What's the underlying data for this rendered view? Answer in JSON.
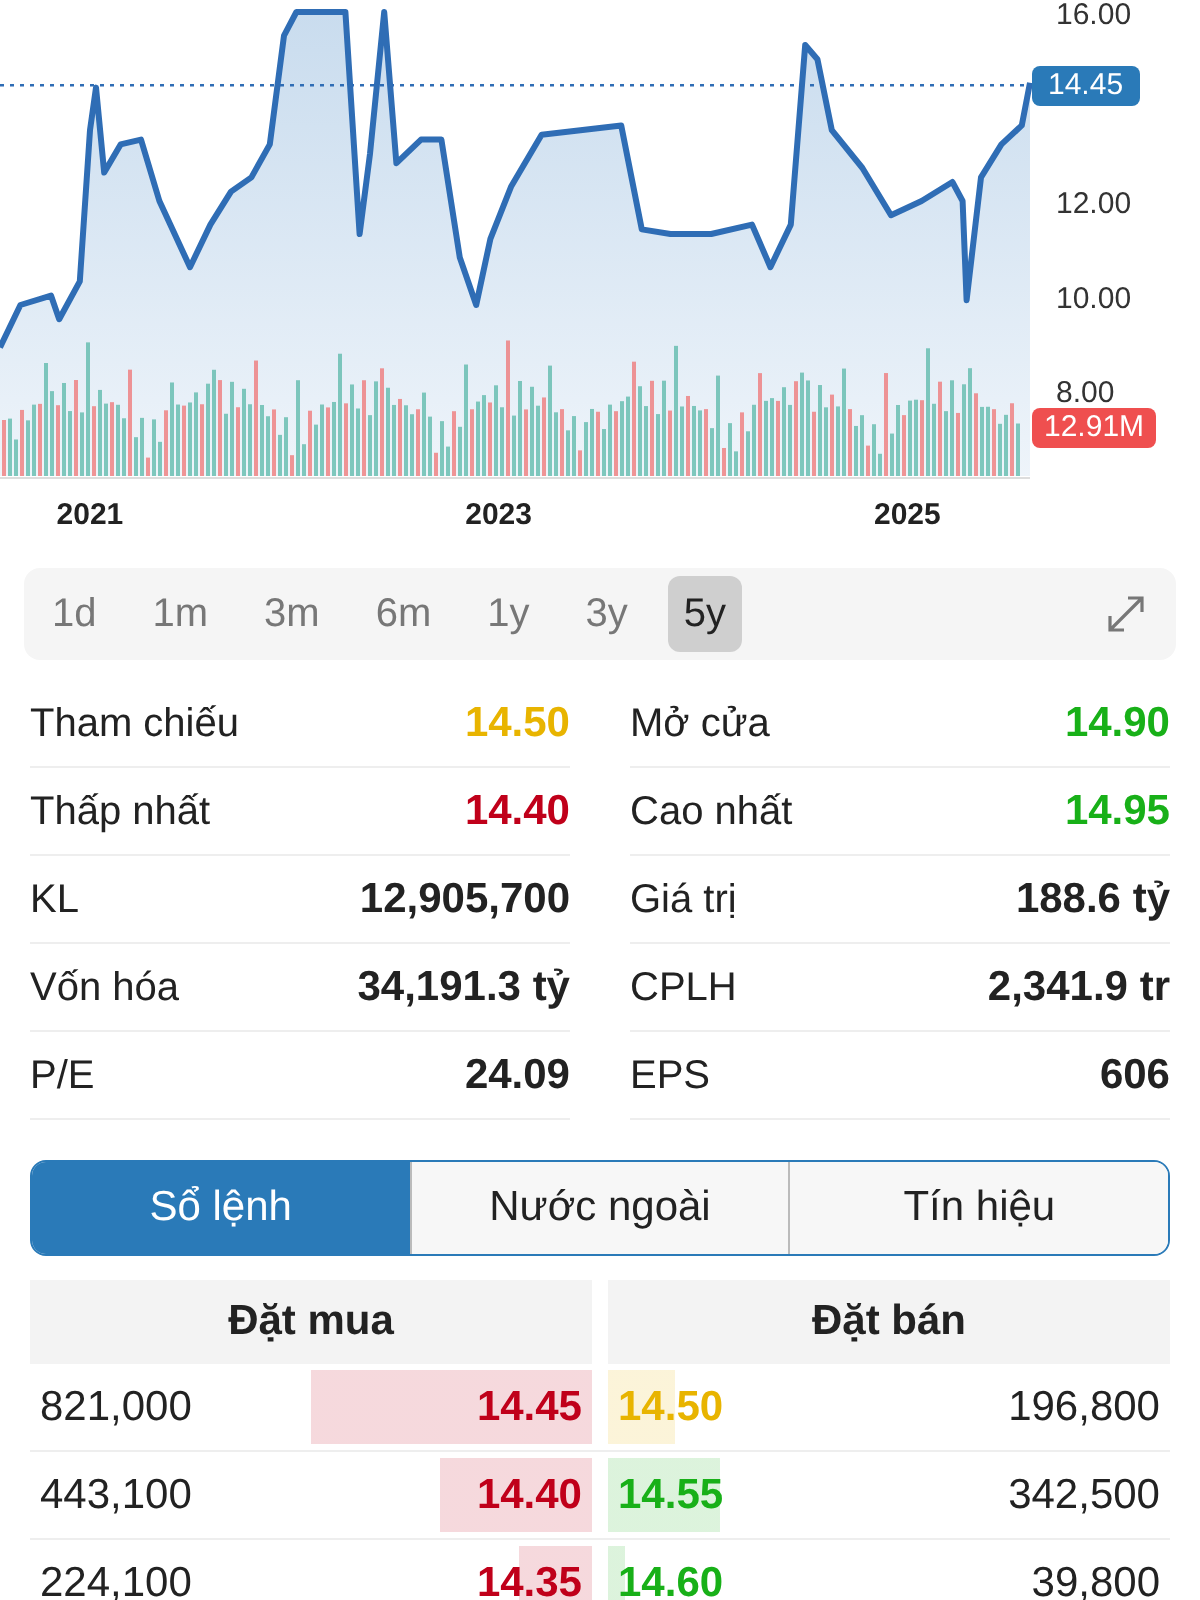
{
  "chart": {
    "chart_data": {
      "type": "area",
      "xlim": [
        2020.56,
        2025.6
      ],
      "ylim": [
        8,
        16
      ],
      "xticks": [
        {
          "value": 2021,
          "label": "2021"
        },
        {
          "value": 2023,
          "label": "2023"
        },
        {
          "value": 2025,
          "label": "2025"
        }
      ],
      "yticks": [
        {
          "value": 8,
          "label": "8.00"
        },
        {
          "value": 10,
          "label": "10.00"
        },
        {
          "value": 12,
          "label": "12.00"
        },
        {
          "value": 16,
          "label": "16.00"
        }
      ],
      "x": [
        2020.56,
        2020.66,
        2020.81,
        2020.85,
        2020.95,
        2021.0,
        2021.03,
        2021.07,
        2021.15,
        2021.25,
        2021.34,
        2021.49,
        2021.59,
        2021.69,
        2021.79,
        2021.88,
        2021.95,
        2022.01,
        2022.13,
        2022.25,
        2022.32,
        2022.37,
        2022.44,
        2022.5,
        2022.62,
        2022.72,
        2022.81,
        2022.89,
        2022.96,
        2023.06,
        2023.21,
        2023.4,
        2023.6,
        2023.7,
        2023.84,
        2024.04,
        2024.24,
        2024.33,
        2024.43,
        2024.5,
        2024.56,
        2024.63,
        2024.78,
        2024.92,
        2025.07,
        2025.22,
        2025.27,
        2025.29,
        2025.36,
        2025.46,
        2025.56,
        2025.6
      ],
      "series": [
        {
          "color": "#2f6db5",
          "values": [
            8.9,
            9.8,
            10.0,
            9.5,
            10.3,
            13.5,
            14.4,
            12.6,
            13.2,
            13.3,
            12.0,
            10.6,
            11.5,
            12.2,
            12.5,
            13.2,
            15.5,
            16.0,
            16.0,
            16.0,
            11.3,
            13.0,
            16.0,
            12.8,
            13.3,
            13.3,
            10.8,
            9.8,
            11.2,
            12.3,
            13.4,
            13.5,
            13.6,
            11.4,
            11.3,
            11.3,
            11.5,
            10.6,
            11.5,
            15.3,
            15.0,
            13.5,
            12.7,
            11.7,
            12.0,
            12.4,
            12.0,
            9.9,
            12.5,
            13.2,
            13.6,
            14.5
          ]
        }
      ]
    },
    "last_price": "14.45",
    "volume_label": "12.91M"
  },
  "periods": [
    {
      "label": "1d",
      "selected": false
    },
    {
      "label": "1m",
      "selected": false
    },
    {
      "label": "3m",
      "selected": false
    },
    {
      "label": "6m",
      "selected": false
    },
    {
      "label": "1y",
      "selected": false
    },
    {
      "label": "3y",
      "selected": false
    },
    {
      "label": "5y",
      "selected": true
    }
  ],
  "stats": [
    {
      "left": {
        "label": "Tham chiếu",
        "value": "14.50",
        "color": "#e8b400"
      },
      "right": {
        "label": "Mở cửa",
        "value": "14.90",
        "color": "#18b018"
      }
    },
    {
      "left": {
        "label": "Thấp nhất",
        "value": "14.40",
        "color": "#c0001a"
      },
      "right": {
        "label": "Cao nhất",
        "value": "14.95",
        "color": "#18b018"
      }
    },
    {
      "left": {
        "label": "KL",
        "value": "12,905,700"
      },
      "right": {
        "label": "Giá trị",
        "value": "188.6 tỷ"
      }
    },
    {
      "left": {
        "label": "Vốn hóa",
        "value": "34,191.3 tỷ"
      },
      "right": {
        "label": "CPLH",
        "value": "2,341.9 tr"
      }
    },
    {
      "left": {
        "label": "P/E",
        "value": "24.09"
      },
      "right": {
        "label": "EPS",
        "value": "606"
      }
    }
  ],
  "section_tabs": [
    {
      "label": "Sổ lệnh",
      "selected": true
    },
    {
      "label": "Nước ngoài",
      "selected": false
    },
    {
      "label": "Tín hiệu",
      "selected": false
    }
  ],
  "order_book": {
    "headers": [
      "Đặt mua",
      "Đặt bán"
    ],
    "rows": [
      {
        "bid_volume": "821,000",
        "bid": {
          "price": "14.45",
          "color": "#c0001a"
        },
        "ask": {
          "price": "14.50",
          "color": "#e8b400"
        },
        "ask_volume": "196,800"
      },
      {
        "bid_volume": "443,100",
        "bid": {
          "price": "14.40",
          "color": "#c0001a"
        },
        "ask": {
          "price": "14.55",
          "color": "#18b018"
        },
        "ask_volume": "342,500"
      },
      {
        "bid_volume": "224,100",
        "bid": {
          "price": "14.35",
          "color": "#c0001a"
        },
        "ask": {
          "price": "14.60",
          "color": "#18b018"
        },
        "ask_volume": "39,800"
      }
    ]
  }
}
